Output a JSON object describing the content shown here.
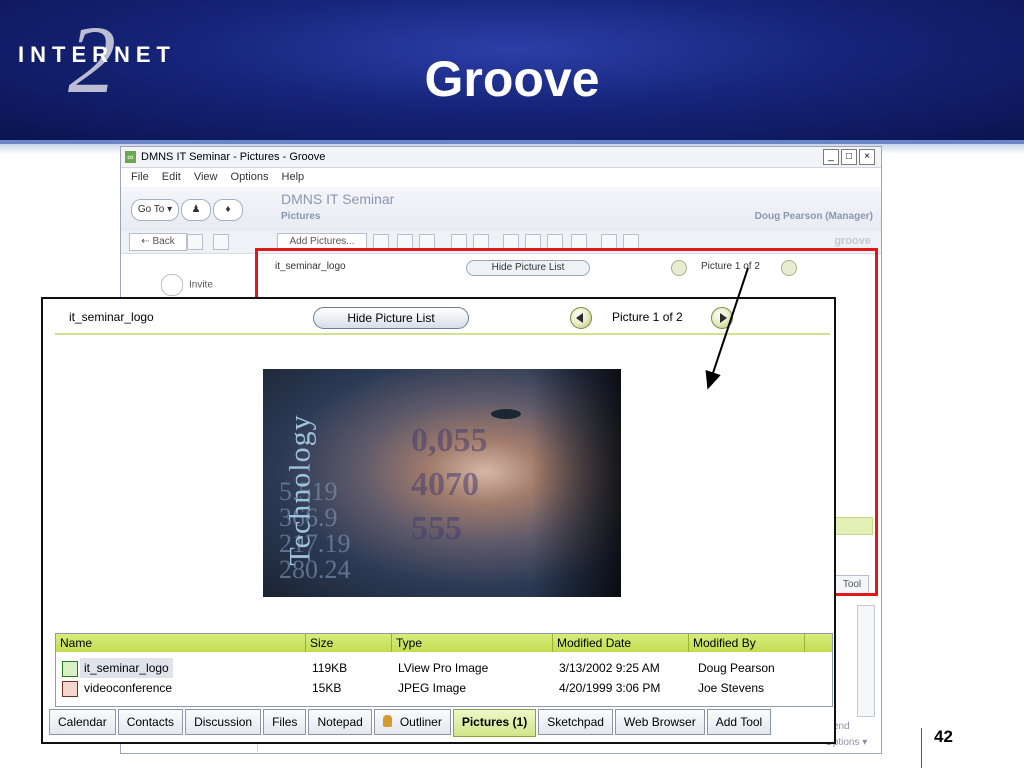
{
  "slide": {
    "title": "Groove",
    "logo_text": "INTERNET",
    "logo_numeral": "2",
    "page_number": "42"
  },
  "window": {
    "title": "DMNS IT Seminar - Pictures - Groove",
    "icon": "groove-icon",
    "menu": [
      "File",
      "Edit",
      "View",
      "Options",
      "Help"
    ],
    "nav": {
      "go_to": "Go To",
      "workspace": "DMNS IT Seminar",
      "tool": "Pictures",
      "user": "Doug Pearson (Manager)"
    },
    "toolbar": {
      "back": "Back",
      "add_pictures": "Add Pictures...",
      "brand": "groove"
    },
    "left": {
      "invite": "Invite"
    },
    "tool_tab_fragment": "Tool",
    "send_fragment": "end",
    "options_fragment": "Options"
  },
  "picture_viewer": {
    "picture_name": "it_seminar_logo",
    "hide_list_button": "Hide Picture List",
    "counter": "Picture 1 of 2",
    "image_text": "Technology",
    "image_numbers": [
      "5.519",
      "366.9",
      "217.19",
      "280.24"
    ],
    "face_numbers": [
      "0,055",
      "4070",
      "555"
    ]
  },
  "file_list": {
    "columns": [
      "Name",
      "Size",
      "Type",
      "Modified Date",
      "Modified By"
    ],
    "rows": [
      {
        "name": "it_seminar_logo",
        "size": "119KB",
        "type": "LView Pro Image",
        "modified": "3/13/2002 9:25 AM",
        "by": "Doug Pearson"
      },
      {
        "name": "videoconference",
        "size": "15KB",
        "type": "JPEG Image",
        "modified": "4/20/1999 3:06 PM",
        "by": "Joe Stevens"
      }
    ]
  },
  "tabs": [
    "Calendar",
    "Contacts",
    "Discussion",
    "Files",
    "Notepad",
    "Outliner",
    "Pictures (1)",
    "Sketchpad",
    "Web Browser",
    "Add Tool"
  ],
  "active_tab": "Pictures (1)",
  "colors": {
    "header_blue": "#16247a",
    "highlight_red": "#e01818",
    "groove_green": "#c3dc52"
  }
}
